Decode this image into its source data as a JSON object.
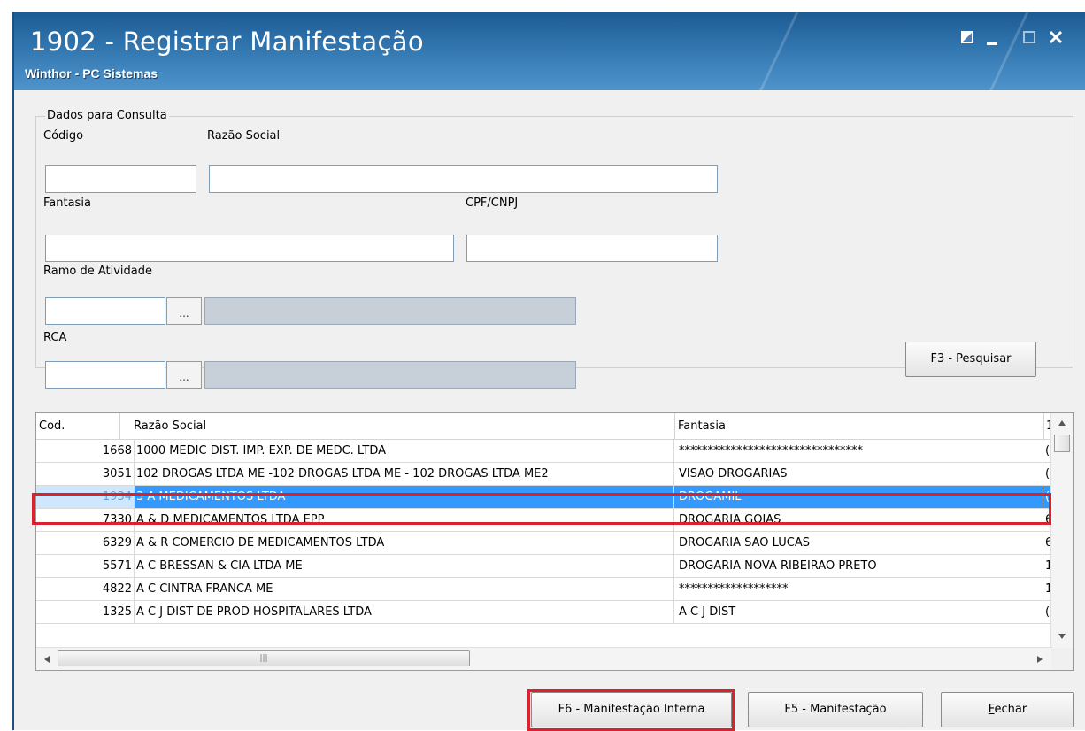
{
  "window": {
    "title": "1902 - Registrar Manifestação",
    "subtitle": "Winthor - PC Sistemas"
  },
  "form": {
    "group_title": "Dados para Consulta",
    "codigo": {
      "label": "Código",
      "value": ""
    },
    "razao_social": {
      "label": "Razão Social",
      "value": ""
    },
    "fantasia": {
      "label": "Fantasia",
      "value": ""
    },
    "cpf_cnpj": {
      "label": "CPF/CNPJ",
      "value": ""
    },
    "ramo": {
      "label": "Ramo de Atividade",
      "value": "",
      "button": "..."
    },
    "rca": {
      "label": "RCA",
      "value": "",
      "button": "..."
    },
    "search_button": "F3 - Pesquisar"
  },
  "grid": {
    "columns": [
      "Cod.",
      "Razão Social",
      "Fantasia",
      "1"
    ],
    "rows": [
      {
        "cod": "1668",
        "razao": "1000 MEDIC DIST. IMP. EXP. DE MEDC. LTDA",
        "fantasia": "********************************",
        "extra": "("
      },
      {
        "cod": "3051",
        "razao": "102 DROGAS LTDA ME -102 DROGAS LTDA ME - 102 DROGAS LTDA ME2",
        "fantasia": "VISAO DROGARIAS",
        "extra": "("
      },
      {
        "cod": "1934",
        "razao": "3 A MEDICAMENTOS LTDA",
        "fantasia": "DROGAMIL",
        "extra": "("
      },
      {
        "cod": "7330",
        "razao": "A & D MEDICAMENTOS LTDA EPP",
        "fantasia": "DROGARIA GOIAS",
        "extra": "6"
      },
      {
        "cod": "6329",
        "razao": "A & R COMERCIO DE MEDICAMENTOS LTDA",
        "fantasia": "DROGARIA SAO LUCAS",
        "extra": "6"
      },
      {
        "cod": "5571",
        "razao": "A C BRESSAN & CIA LTDA ME",
        "fantasia": "DROGARIA NOVA RIBEIRAO PRETO",
        "extra": "1"
      },
      {
        "cod": "4822",
        "razao": "A C CINTRA FRANCA ME",
        "fantasia": "*******************",
        "extra": "1"
      },
      {
        "cod": "1325",
        "razao": "A C J DIST DE PROD HOSPITALARES LTDA",
        "fantasia": "A C J DIST",
        "extra": "("
      }
    ],
    "selected_index": 2
  },
  "buttons": {
    "f6": "F6 - Manifestação Interna",
    "f5": "F5 - Manifestação",
    "fechar_f": "F",
    "fechar_rest": "echar"
  },
  "colors": {
    "highlight": "#d6232e",
    "selection": "#3399ff",
    "titlebar": "#2f73ad"
  }
}
